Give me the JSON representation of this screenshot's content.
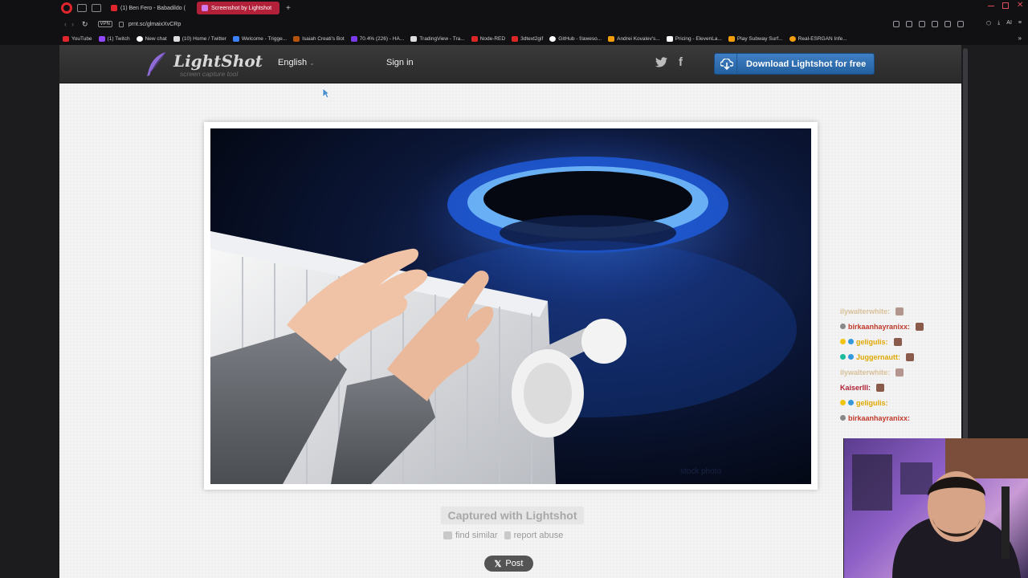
{
  "browser": {
    "tabs": [
      {
        "label": "(1) Ben Fero - Babadildo (",
        "active": false,
        "color": "#e0262c"
      },
      {
        "label": "Screenshot by Lightshot",
        "active": true,
        "color": "#9b59b6"
      }
    ],
    "url": "prnt.sc/glmaixXvCRp",
    "vpn_label": "VPN",
    "ai_label": "AI",
    "bookmarks": [
      {
        "label": "YouTube",
        "color": "#e0262c"
      },
      {
        "label": "(1) Twitch",
        "color": "#9146ff"
      },
      {
        "label": "New chat",
        "color": "#ffffff"
      },
      {
        "label": "(10) Home / Twitter",
        "color": "#dddddd"
      },
      {
        "label": "Welcome - Trigge...",
        "color": "#3b82f6"
      },
      {
        "label": "Isaiah Creati's Bot",
        "color": "#b45309"
      },
      {
        "label": "70.4% (226) - HA...",
        "color": "#7c3aed"
      },
      {
        "label": "TradingView - Tra...",
        "color": "#dddddd"
      },
      {
        "label": "Node-RED",
        "color": "#dc2626"
      },
      {
        "label": "3dtext2gif",
        "color": "#dc2626"
      },
      {
        "label": "GitHub - f/aweso...",
        "color": "#ffffff"
      },
      {
        "label": "Andrei Kovalev's...",
        "color": "#f59e0b"
      },
      {
        "label": "Pricing - ElevenLa...",
        "color": "#ffffff"
      },
      {
        "label": "Play Subway Surf...",
        "color": "#f59e0b"
      },
      {
        "label": "Real-ESRGAN Infe...",
        "color": "#f59e0b"
      }
    ]
  },
  "lightshot": {
    "logo_name": "LightShot",
    "logo_tagline": "screen capture tool",
    "language": "English",
    "signin": "Sign in",
    "download_button": "Download Lightshot for free",
    "captured": "Captured with Lightshot",
    "find_similar": "find similar",
    "report_abuse": "report abuse",
    "post_button": "Post",
    "brand_color": "#2e6fb0"
  },
  "stream": {
    "chat": [
      {
        "user": "ilywalterwhite:",
        "color": "#c8a060",
        "faded": true
      },
      {
        "user": "birkaanhayranixx:",
        "color": "#c0392b",
        "faded": false
      },
      {
        "user": "geligulis:",
        "color": "#e0a800",
        "faded": false
      },
      {
        "user": "Juggernautt:",
        "color": "#e0a800",
        "faded": false
      },
      {
        "user": "ilywalterwhite:",
        "color": "#c8a060",
        "faded": true
      },
      {
        "user": "KaiserIII:",
        "color": "#b22234",
        "faded": false
      },
      {
        "user": "geligulis:",
        "color": "#e0a800",
        "faded": false
      },
      {
        "user": "birkaanhayranixx:",
        "color": "#c0392b",
        "faded": false
      }
    ]
  }
}
